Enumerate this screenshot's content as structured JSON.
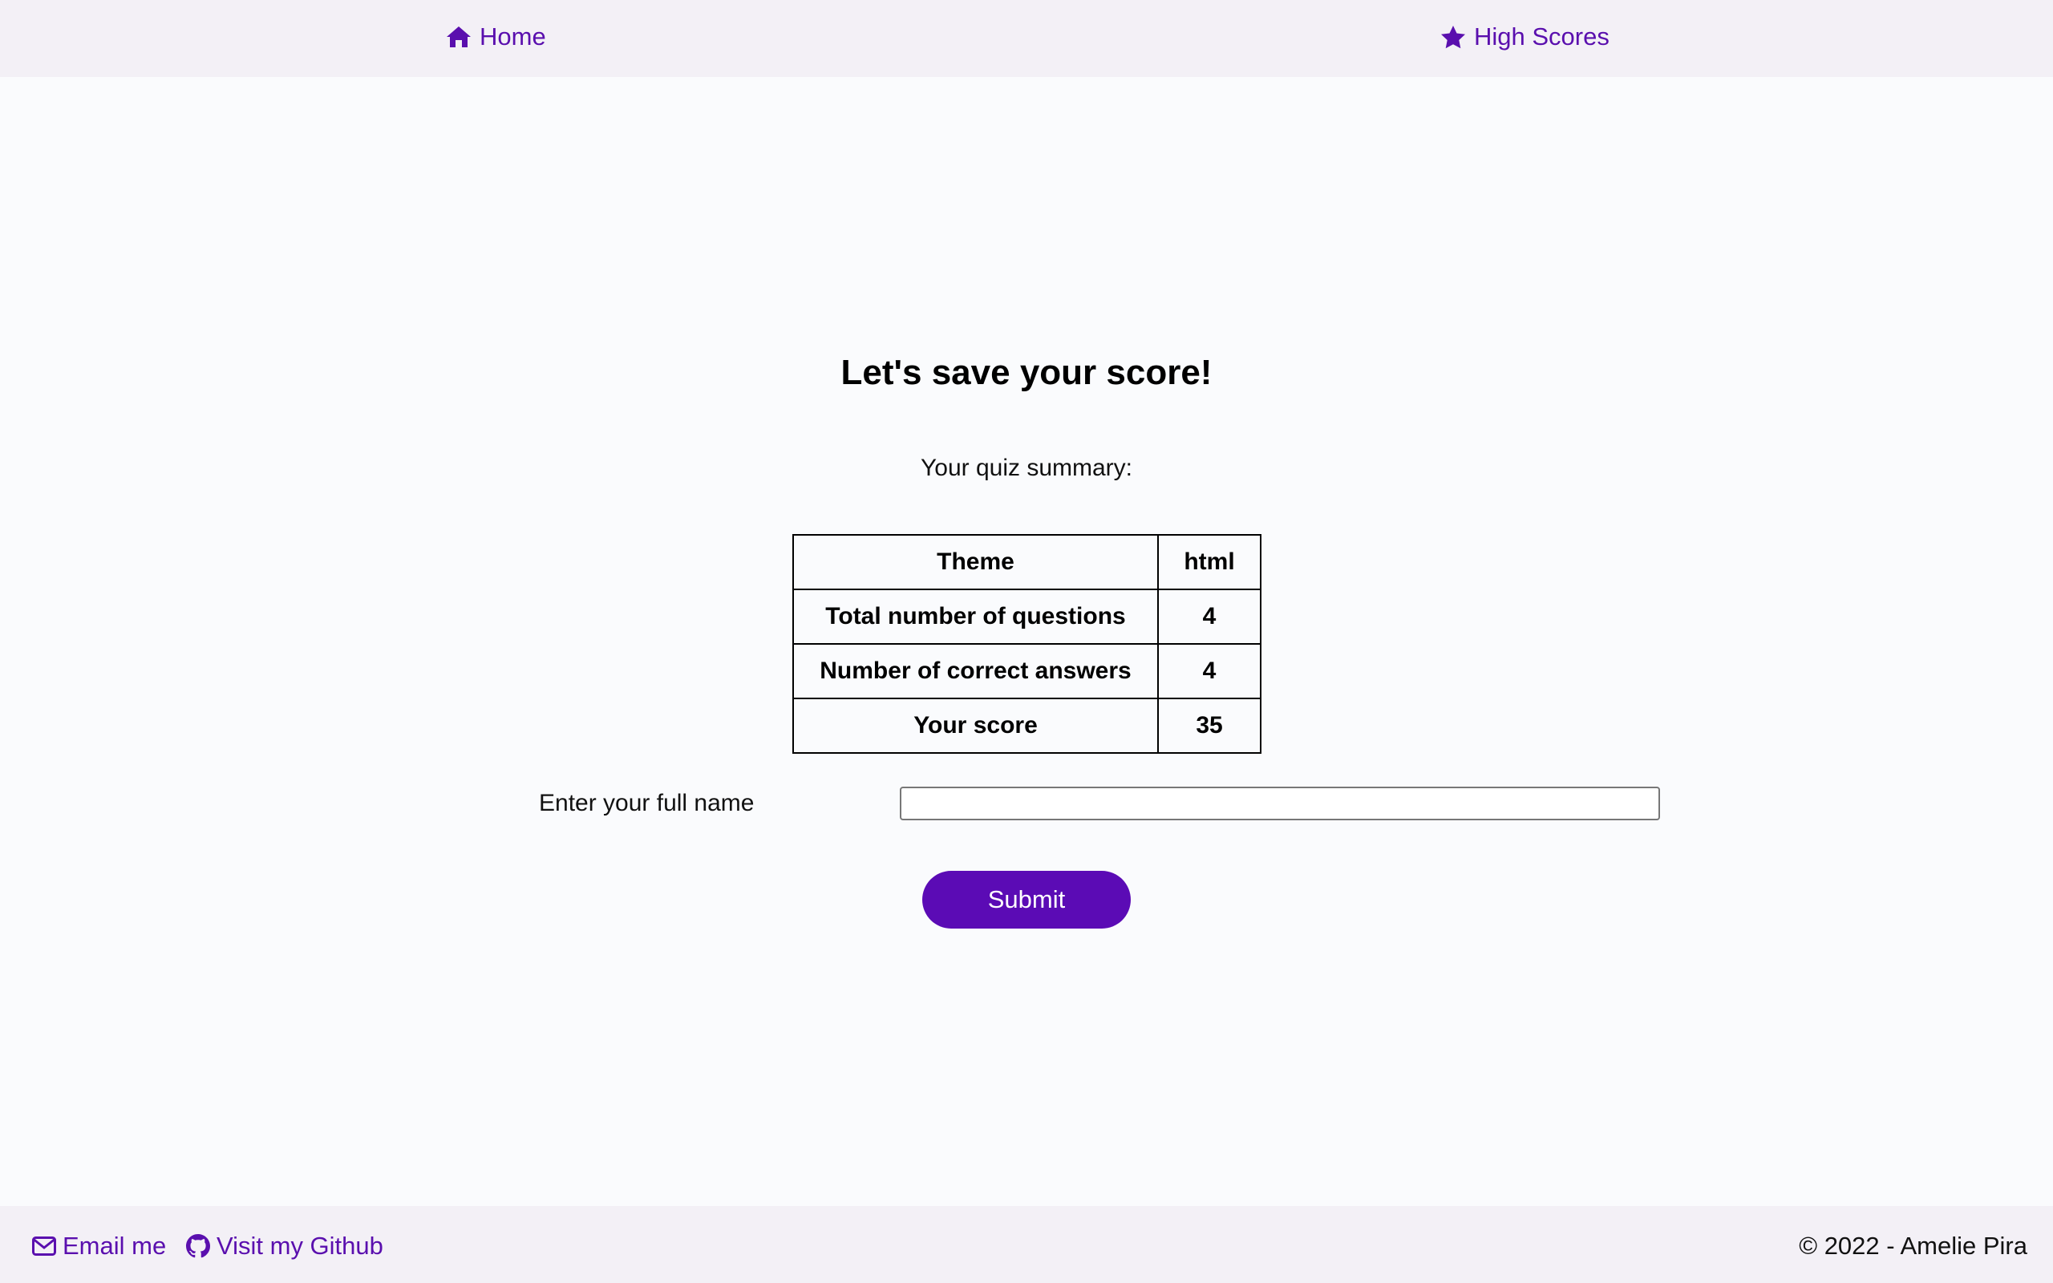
{
  "nav": {
    "home_label": "Home",
    "home_icon": "home-icon",
    "high_scores_label": "High Scores",
    "high_scores_icon": "star-icon"
  },
  "main": {
    "title": "Let's save your score!",
    "subtitle": "Your quiz summary:",
    "summary_rows": [
      {
        "label": "Theme",
        "value": "html"
      },
      {
        "label": "Total number of questions",
        "value": "4"
      },
      {
        "label": "Number of correct answers",
        "value": "4"
      },
      {
        "label": "Your score",
        "value": "35"
      }
    ],
    "name_label": "Enter your full name",
    "name_value": "",
    "submit_label": "Submit"
  },
  "footer": {
    "email_label": "Email me",
    "email_icon": "envelope-icon",
    "github_label": "Visit my Github",
    "github_icon": "github-icon",
    "copyright": "© 2022 - Amelie Pira"
  },
  "colors": {
    "accent": "#5b0bb5",
    "bar_background": "#f3f0f6",
    "page_background": "#fafbfd"
  }
}
